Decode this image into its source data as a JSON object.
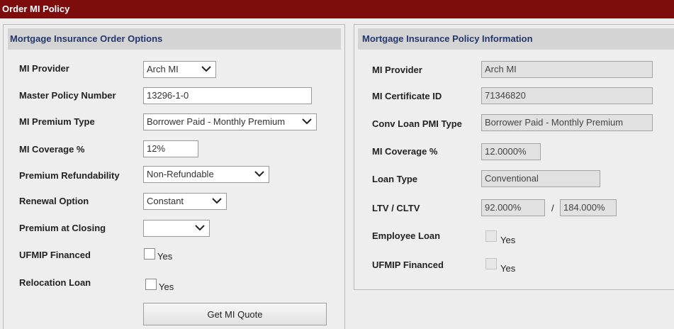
{
  "title": "Order MI Policy",
  "order_options": {
    "header": "Mortgage Insurance Order Options",
    "mi_provider": {
      "label": "MI Provider",
      "value": "Arch MI"
    },
    "master_policy": {
      "label": "Master Policy Number",
      "value": "13296-1-0"
    },
    "premium_type": {
      "label": "MI Premium Type",
      "value": "Borrower Paid - Monthly Premium"
    },
    "coverage": {
      "label": "MI Coverage %",
      "value": "12%"
    },
    "refundability": {
      "label": "Premium Refundability",
      "value": "Non-Refundable"
    },
    "renewal": {
      "label": "Renewal Option",
      "value": "Constant"
    },
    "premium_closing": {
      "label": "Premium at Closing",
      "value": ""
    },
    "ufmip": {
      "label": "UFMIP Financed",
      "checkbox_label": "Yes",
      "checked": false
    },
    "relocation": {
      "label": "Relocation Loan",
      "checkbox_label": "Yes",
      "checked": false
    },
    "quote_button": "Get MI Quote"
  },
  "policy_info": {
    "header": "Mortgage Insurance Policy Information",
    "mi_provider": {
      "label": "MI Provider",
      "value": "Arch MI"
    },
    "certificate": {
      "label": "MI Certificate ID",
      "value": "71346820"
    },
    "pmi_type": {
      "label": "Conv Loan PMI Type",
      "value": "Borrower Paid - Monthly Premium"
    },
    "coverage": {
      "label": "MI Coverage %",
      "value": "12.0000%"
    },
    "loan_type": {
      "label": "Loan Type",
      "value": "Conventional"
    },
    "ltv": {
      "label": "LTV / CLTV",
      "ltv_value": "92.000%",
      "separator": "/",
      "cltv_value": "184.000%"
    },
    "employee_loan": {
      "label": "Employee Loan",
      "checkbox_label": "Yes",
      "checked": false
    },
    "ufmip": {
      "label": "UFMIP Financed",
      "checkbox_label": "Yes",
      "checked": false
    }
  },
  "colors": {
    "title_bar": "#7d0c0c",
    "header_text": "#24376d"
  },
  "icons": {
    "dropdown": "chevron-down-icon"
  }
}
